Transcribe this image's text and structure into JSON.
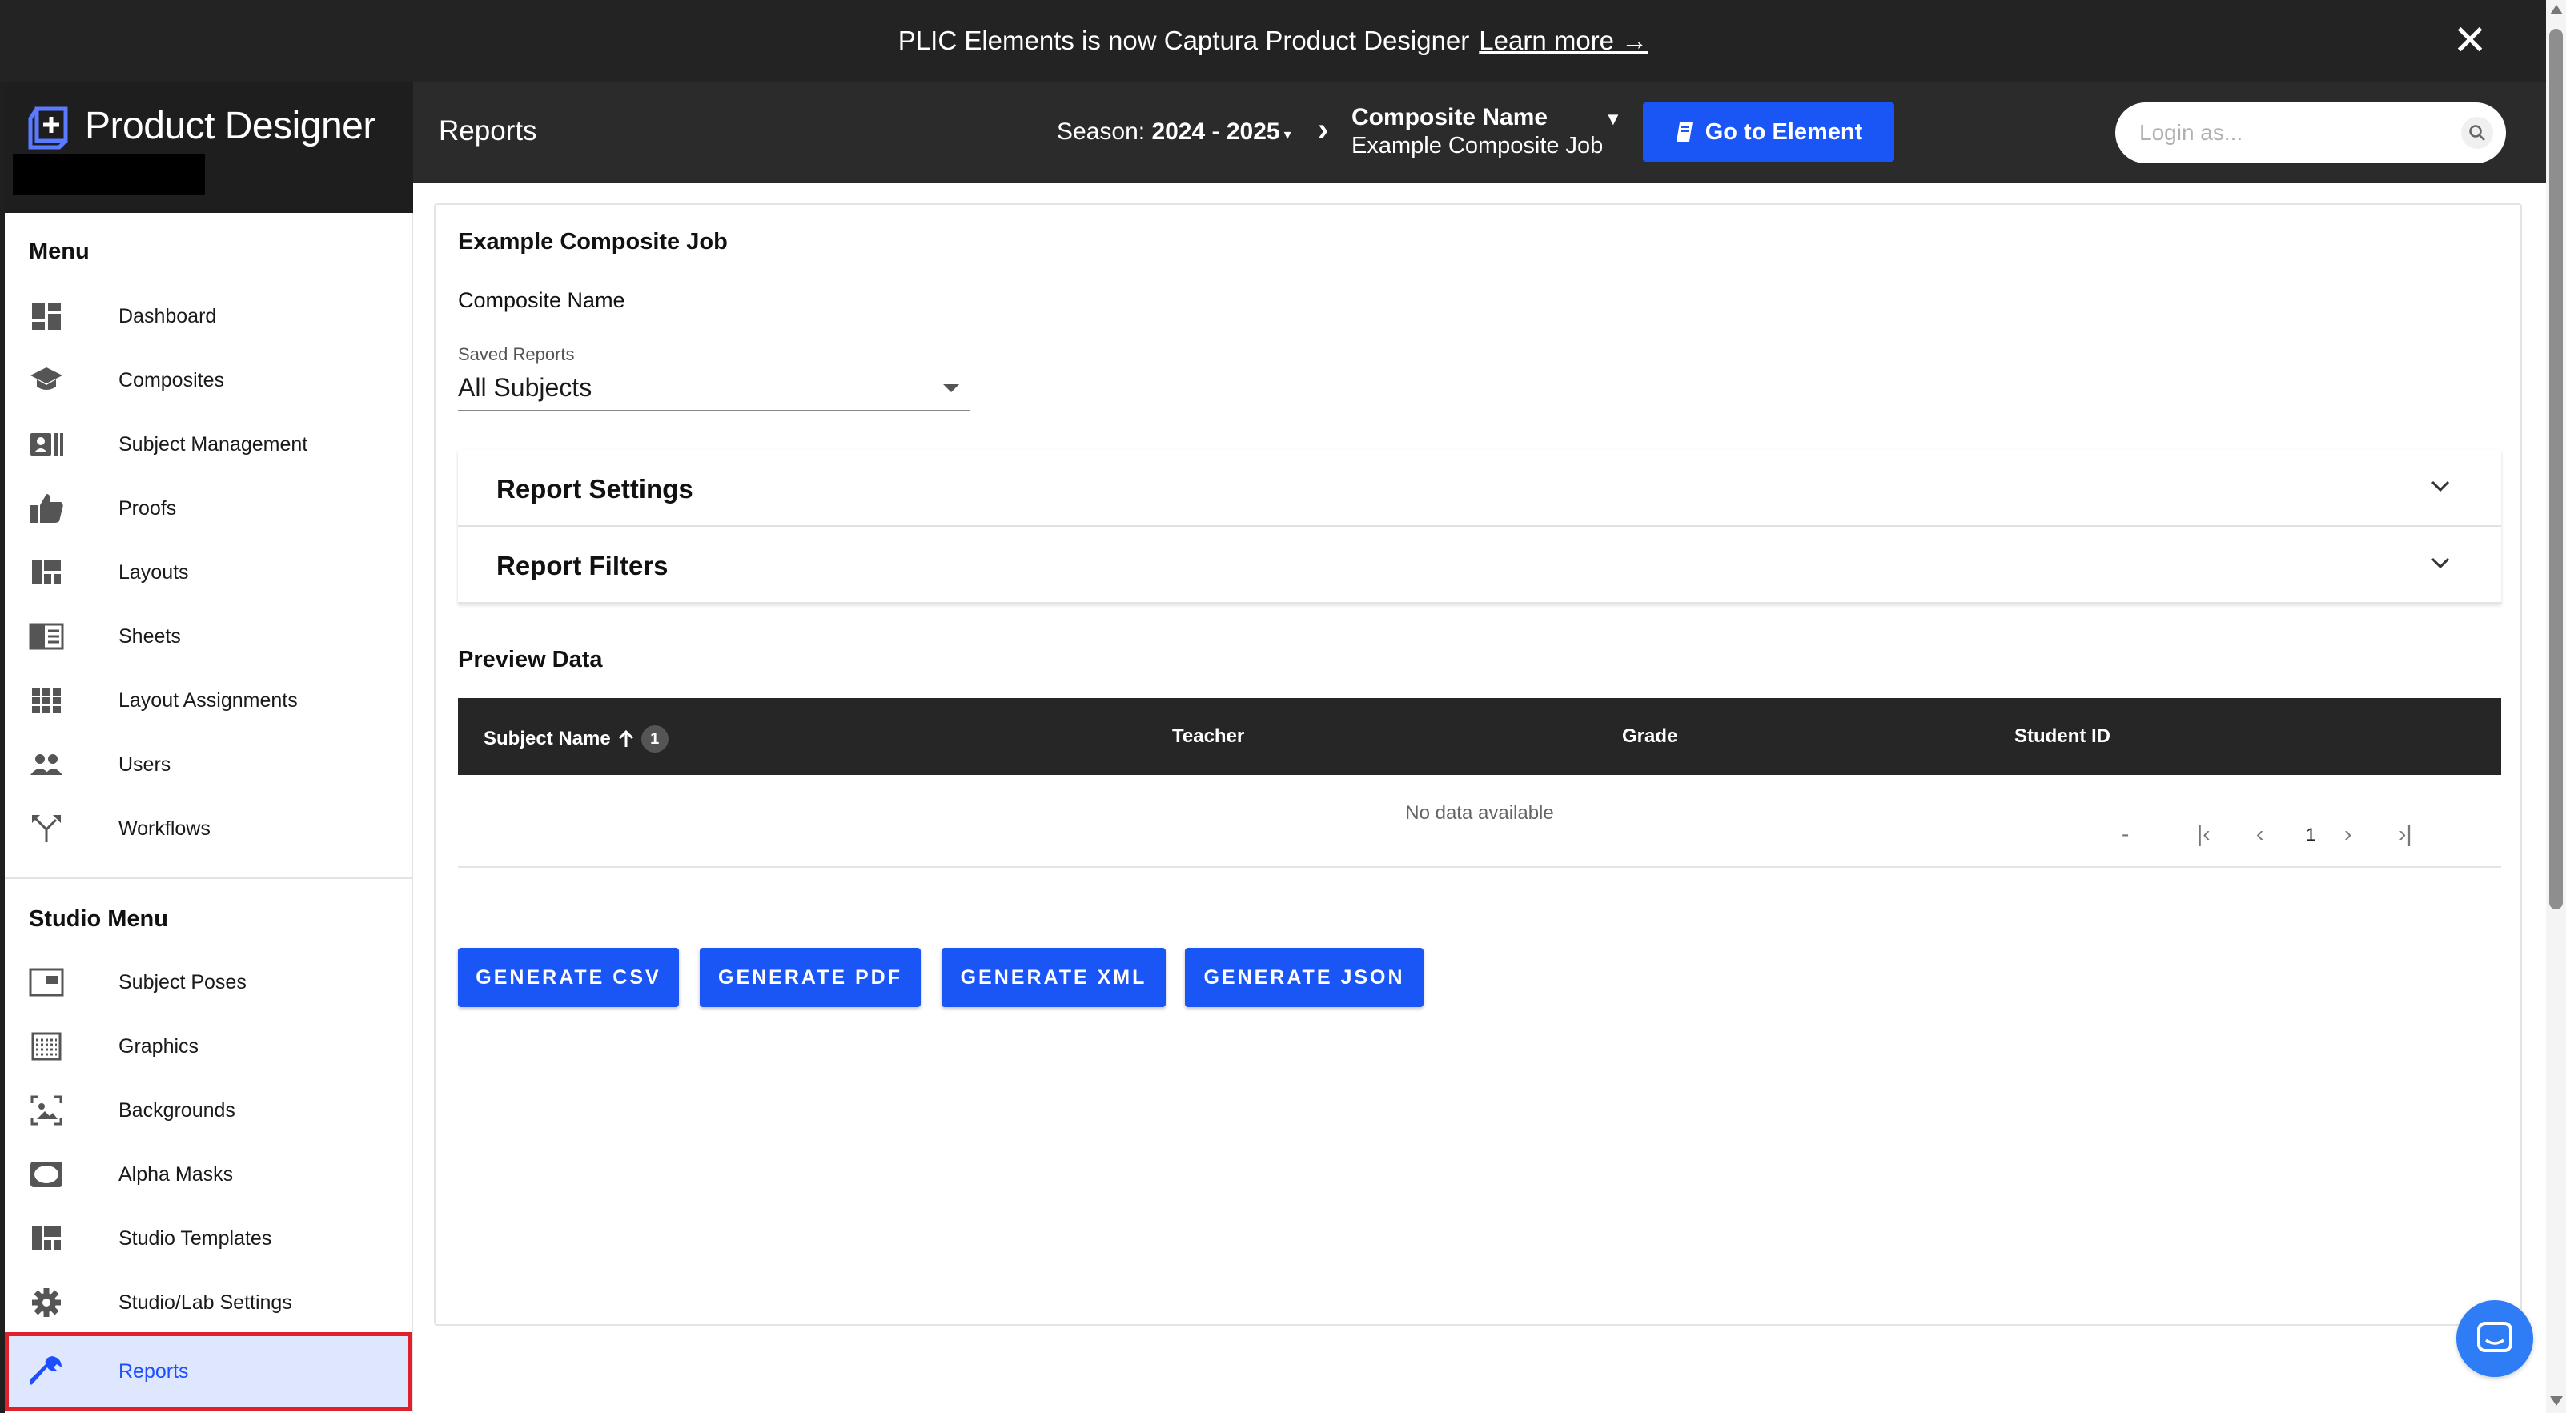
{
  "banner": {
    "text": "PLIC Elements is now Captura Product Designer",
    "link": "Learn more →",
    "close": "✕"
  },
  "brand": {
    "name": "Product Designer"
  },
  "sidebar": {
    "menu_title": "Menu",
    "menu_items": [
      {
        "label": "Dashboard",
        "icon": "dashboard-icon"
      },
      {
        "label": "Composites",
        "icon": "graduation-cap-icon"
      },
      {
        "label": "Subject Management",
        "icon": "contact-card-icon"
      },
      {
        "label": "Proofs",
        "icon": "thumbs-up-icon"
      },
      {
        "label": "Layouts",
        "icon": "layout-icon"
      },
      {
        "label": "Sheets",
        "icon": "sheet-icon"
      },
      {
        "label": "Layout Assignments",
        "icon": "grid-icon"
      },
      {
        "label": "Users",
        "icon": "users-icon"
      },
      {
        "label": "Workflows",
        "icon": "workflow-icon"
      }
    ],
    "studio_title": "Studio Menu",
    "studio_items": [
      {
        "label": "Subject Poses",
        "icon": "poses-icon"
      },
      {
        "label": "Graphics",
        "icon": "graphics-icon"
      },
      {
        "label": "Backgrounds",
        "icon": "backgrounds-icon"
      },
      {
        "label": "Alpha Masks",
        "icon": "alpha-mask-icon"
      },
      {
        "label": "Studio Templates",
        "icon": "templates-icon"
      },
      {
        "label": "Studio/Lab Settings",
        "icon": "gear-icon"
      },
      {
        "label": "Reports",
        "icon": "wrench-icon",
        "active": true
      }
    ]
  },
  "header": {
    "title": "Reports",
    "season_label": "Season:",
    "season_value": "2024 - 2025",
    "composite_name": "Composite Name",
    "composite_job": "Example Composite Job",
    "goto_label": "Go to Element",
    "login_placeholder": "Login as..."
  },
  "main": {
    "job_title": "Example Composite Job",
    "composite_label": "Composite Name",
    "saved_reports_label": "Saved Reports",
    "saved_reports_value": "All Subjects",
    "panels": [
      "Report Settings",
      "Report Filters"
    ],
    "preview_title": "Preview Data",
    "table": {
      "columns": [
        "Subject Name",
        "Teacher",
        "Grade",
        "Student ID"
      ],
      "sort_badge": "1",
      "empty_text": "No data available"
    },
    "pager": {
      "range": "-",
      "page": "1"
    },
    "buttons": [
      "GENERATE CSV",
      "GENERATE PDF",
      "GENERATE XML",
      "GENERATE JSON"
    ]
  },
  "colors": {
    "accent": "#1a55f5",
    "active_bg": "#dfe7ff",
    "highlight_border": "#e0202a",
    "header_bg": "#2b2b2b"
  }
}
